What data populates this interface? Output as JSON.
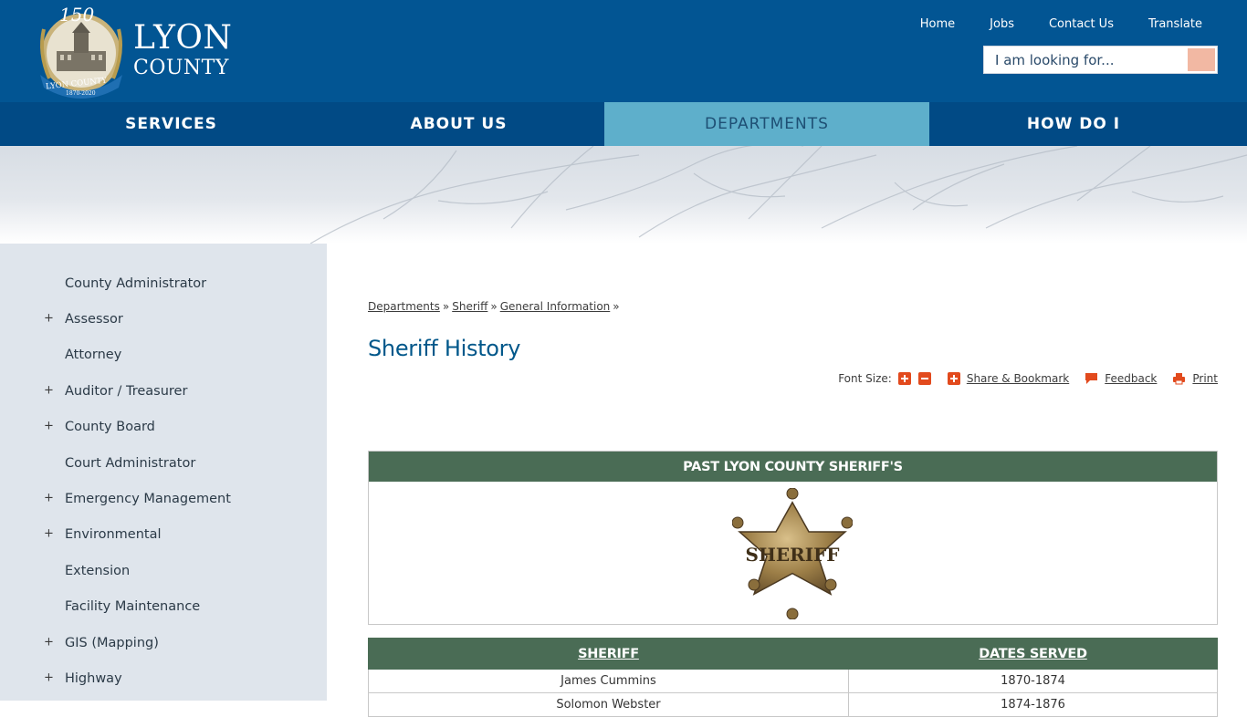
{
  "logo": {
    "seal_top": "150",
    "seal_ring": "LYON COUNTY",
    "seal_years": "1870-2020",
    "line1": "LYON",
    "line2": "COUNTY"
  },
  "utility_nav": [
    {
      "label": "Home"
    },
    {
      "label": "Jobs"
    },
    {
      "label": "Contact Us"
    },
    {
      "label": "Translate"
    }
  ],
  "search": {
    "placeholder": "I am looking for..."
  },
  "main_nav": [
    {
      "label": "SERVICES",
      "active": false
    },
    {
      "label": "ABOUT US",
      "active": false
    },
    {
      "label": "DEPARTMENTS",
      "active": true
    },
    {
      "label": "HOW DO I",
      "active": false
    }
  ],
  "sidebar": {
    "items": [
      {
        "label": "County Administrator",
        "expandable": false
      },
      {
        "label": "Assessor",
        "expandable": true
      },
      {
        "label": "Attorney",
        "expandable": false
      },
      {
        "label": "Auditor / Treasurer",
        "expandable": true
      },
      {
        "label": "County Board",
        "expandable": true
      },
      {
        "label": "Court Administrator",
        "expandable": false
      },
      {
        "label": "Emergency Management",
        "expandable": true
      },
      {
        "label": "Environmental",
        "expandable": true
      },
      {
        "label": "Extension",
        "expandable": false
      },
      {
        "label": "Facility Maintenance",
        "expandable": false
      },
      {
        "label": "GIS (Mapping)",
        "expandable": true
      },
      {
        "label": "Highway",
        "expandable": true
      }
    ],
    "expand_symbol": "+"
  },
  "breadcrumb": {
    "items": [
      "Departments",
      "Sheriff",
      "General Information"
    ],
    "separator": "»"
  },
  "page_title": "Sheriff History",
  "tools": {
    "font_size_label": "Font Size:",
    "share_label": "Share & Bookmark",
    "feedback_label": "Feedback",
    "print_label": "Print"
  },
  "badge_table": {
    "header": "PAST LYON COUNTY SHERIFF'S",
    "badge_text": "SHERIFF"
  },
  "sheriff_table": {
    "headers": [
      "SHERIFF",
      "DATES SERVED"
    ],
    "rows": [
      [
        "James Cummins",
        "1870-1874"
      ],
      [
        "Solomon Webster",
        "1874-1876"
      ]
    ]
  },
  "colors": {
    "header_blue": "#025593",
    "nav_blue": "#014a85",
    "nav_active": "#5eafcb",
    "table_green": "#4a6c55",
    "accent_orange": "#e24a1d",
    "title_blue": "#00578a"
  }
}
